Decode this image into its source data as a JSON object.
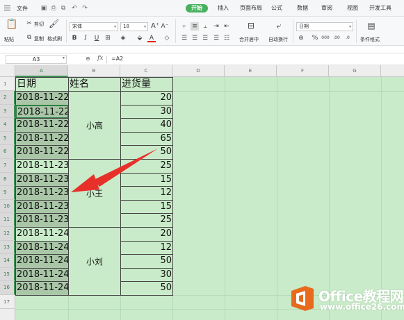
{
  "menubar": {
    "file_label": "文件",
    "tabs": [
      "开始",
      "插入",
      "页面布局",
      "公式",
      "数据",
      "审阅",
      "视图",
      "开发工具"
    ]
  },
  "ribbon": {
    "paste_label": "粘贴",
    "cut_label": "剪切",
    "copy_label": "复制",
    "format_painter_label": "格式刷",
    "font_name": "宋体",
    "font_size": "18",
    "merge_center_label": "合并居中",
    "wrap_text_label": "自动换行",
    "number_format": "日期",
    "conditional_format_label": "条件格式",
    "bold_glyph": "B",
    "italic_glyph": "I",
    "underline_glyph": "U"
  },
  "formula_bar": {
    "cell_ref": "A3",
    "fx_label": "fx",
    "formula": "=A2"
  },
  "sheet": {
    "columns": [
      "A",
      "B",
      "C",
      "D",
      "E",
      "F",
      "G"
    ],
    "rows": [
      "1",
      "2",
      "3",
      "4",
      "5",
      "6",
      "7",
      "8",
      "9",
      "10",
      "11",
      "12",
      "13",
      "14",
      "15",
      "16",
      "17"
    ],
    "headers": {
      "date": "日期",
      "name": "姓名",
      "qty": "进货量"
    },
    "dates": [
      "2018-11-22",
      "2018-11-22",
      "2018-11-22",
      "2018-11-22",
      "2018-11-22",
      "2018-11-23",
      "2018-11-23",
      "2018-11-23",
      "2018-11-23",
      "2018-11-23",
      "2018-11-24",
      "2018-11-24",
      "2018-11-24",
      "2018-11-24",
      "2018-11-24"
    ],
    "names": [
      "小高",
      "小王",
      "小刘"
    ],
    "quantities": [
      "20",
      "30",
      "40",
      "65",
      "50",
      "25",
      "15",
      "12",
      "15",
      "25",
      "20",
      "12",
      "50",
      "30",
      "50"
    ]
  },
  "watermark": {
    "title": "Office教程网",
    "url": "www.office26.com"
  },
  "colors": {
    "accent": "#47b15d",
    "sheet_fill": "#c9ebc9",
    "selection_fill": "#a9c6a7",
    "arrow": "#e8302a",
    "logo": "#e86a1c"
  }
}
